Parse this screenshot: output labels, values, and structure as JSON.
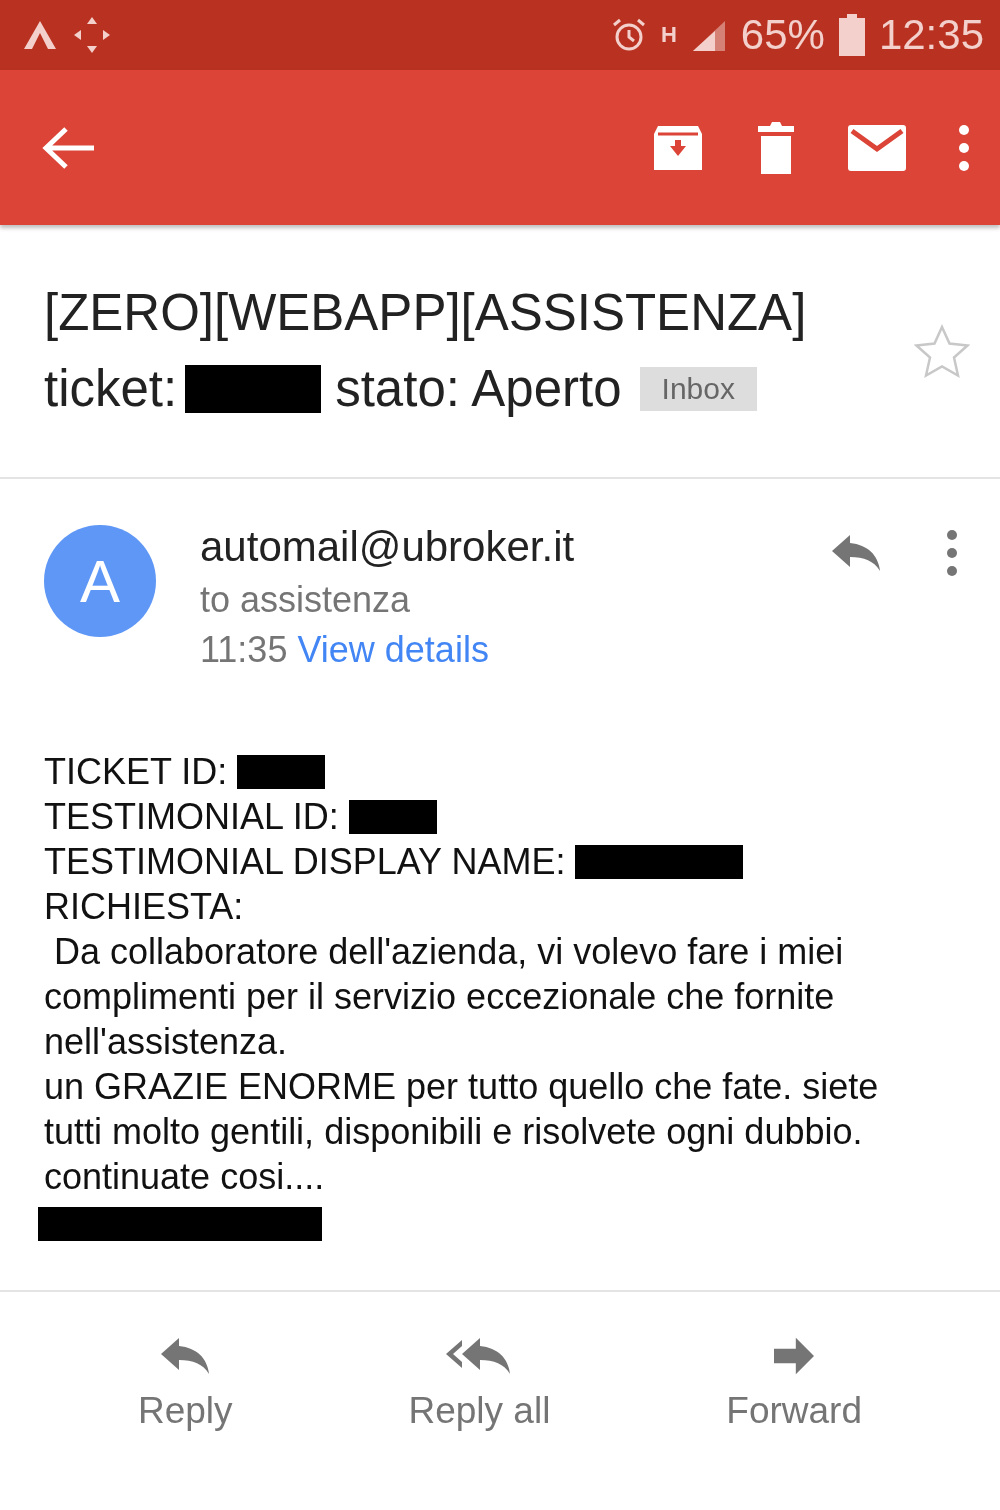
{
  "status_bar": {
    "network_type": "H",
    "battery": "65%",
    "time": "12:35"
  },
  "subject": {
    "lines": [
      [
        {
          "kind": "text",
          "text": "[ZERO][WEBAPP][ASSISTENZA]"
        }
      ],
      [
        {
          "kind": "text",
          "text": "ticket:"
        },
        {
          "kind": "redacted"
        },
        {
          "kind": "text",
          "text": "stato: Aperto"
        },
        {
          "kind": "label",
          "text": "Inbox"
        }
      ]
    ],
    "starred": false
  },
  "message": {
    "avatar_letter": "A",
    "sender": "automail@ubroker.it",
    "recipient": "to assistenza",
    "time": "11:35",
    "details_link": "View details",
    "body": [
      {
        "text": "TICKET ID:",
        "redacted": true
      },
      {
        "text": "TESTIMONIAL ID:",
        "redacted": true
      },
      {
        "text": "TESTIMONIAL DISPLAY NAME:",
        "redacted": true
      },
      {
        "text": "RICHIESTA:",
        "redacted": false
      },
      {
        "text": " Da collaboratore dell'azienda, vi volevo fare i miei complimenti per il servizio eccezionale che fornite nell'assistenza.",
        "redacted": false
      },
      {
        "text": "un GRAZIE ENORME per tutto quello che fate. siete tutti molto gentili, disponibili e risolvete ogni dubbio.",
        "redacted": false
      },
      {
        "text": "continuate cosi....",
        "redacted": false
      },
      {
        "redacted": true
      }
    ]
  },
  "actions": [
    {
      "kind": "reply",
      "label": "Reply"
    },
    {
      "kind": "reply_all",
      "label": "Reply all"
    },
    {
      "kind": "forward",
      "label": "Forward"
    }
  ]
}
